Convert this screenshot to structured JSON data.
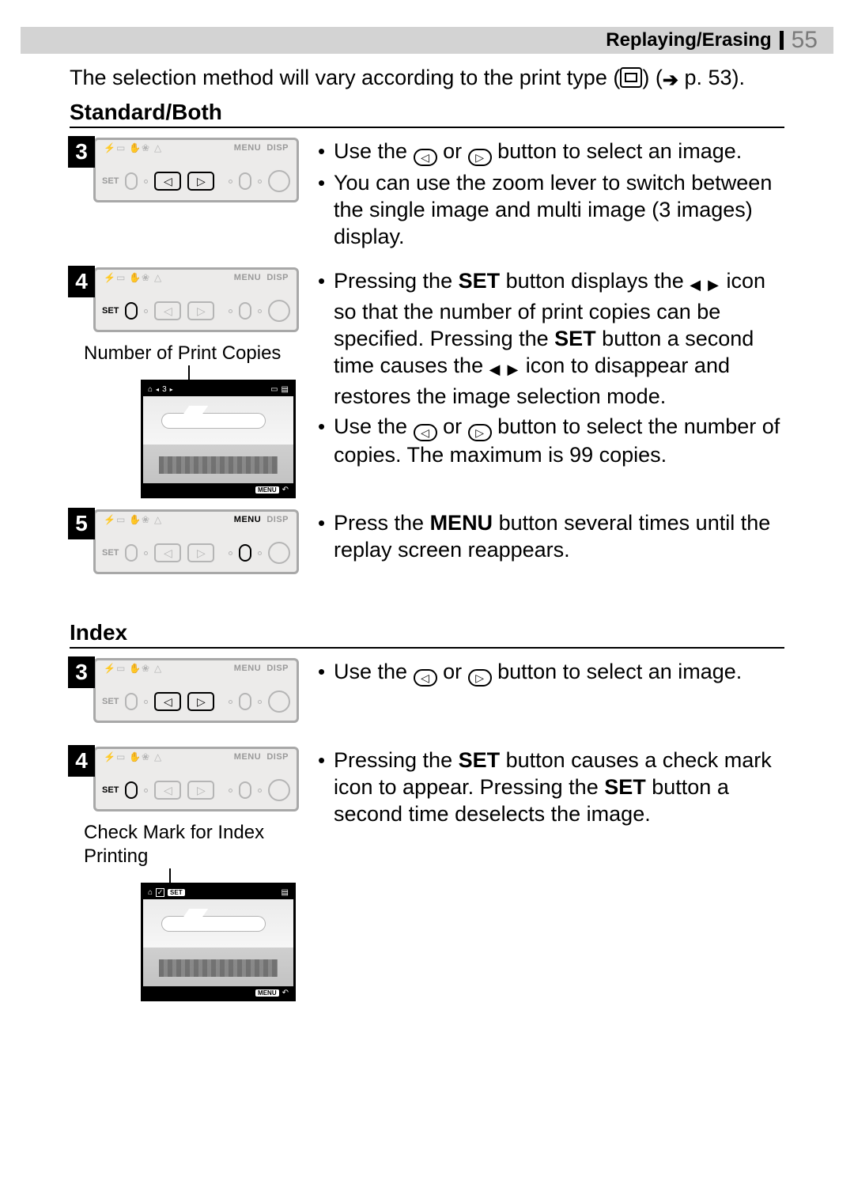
{
  "header": {
    "section": "Replaying/Erasing",
    "page": "55"
  },
  "intro": {
    "text_a": "The selection method will vary according to the print type (",
    "text_b": ") (",
    "text_c": " p. 53)."
  },
  "panel_labels": {
    "set": "SET",
    "menu": "MENU",
    "disp": "DISP"
  },
  "standard": {
    "heading": "Standard/Both",
    "steps": {
      "s3": "3",
      "s4": "4",
      "s5": "5"
    },
    "caption4": "Number of Print Copies",
    "photo_top_count": "3",
    "bullets3": {
      "b1a": "Use the ",
      "b1b": " or ",
      "b1c": " button to select an image.",
      "b2": "You can use the zoom lever to switch between the single image and multi image (3 images) display."
    },
    "bullets4": {
      "b1a": "Pressing the ",
      "b1_set": "SET",
      "b1b": " button displays the ",
      "b1c": " icon so that the number of print copies can be specified. Pressing the ",
      "b1_set2": "SET",
      "b1d": " button a second time causes the ",
      "b1e": " icon to disappear and restores the image selection mode.",
      "b2a": "Use the ",
      "b2b": " or ",
      "b2c": " button to select the number of copies. The maximum is 99 copies."
    },
    "bullets5": {
      "b1a": "Press the ",
      "b1_menu": "MENU",
      "b1b": " button several times until the replay screen reappears."
    }
  },
  "index": {
    "heading": "Index",
    "steps": {
      "s3": "3",
      "s4": "4"
    },
    "caption4": "Check Mark for Index Printing",
    "bullets3": {
      "b1a": "Use the ",
      "b1b": " or ",
      "b1c": " button to select an image."
    },
    "bullets4": {
      "b1a": "Pressing the ",
      "b1_set": "SET",
      "b1b": " button causes a check mark icon to appear. Pressing the ",
      "b1_set2": "SET",
      "b1c": " button a second time deselects the image."
    }
  }
}
